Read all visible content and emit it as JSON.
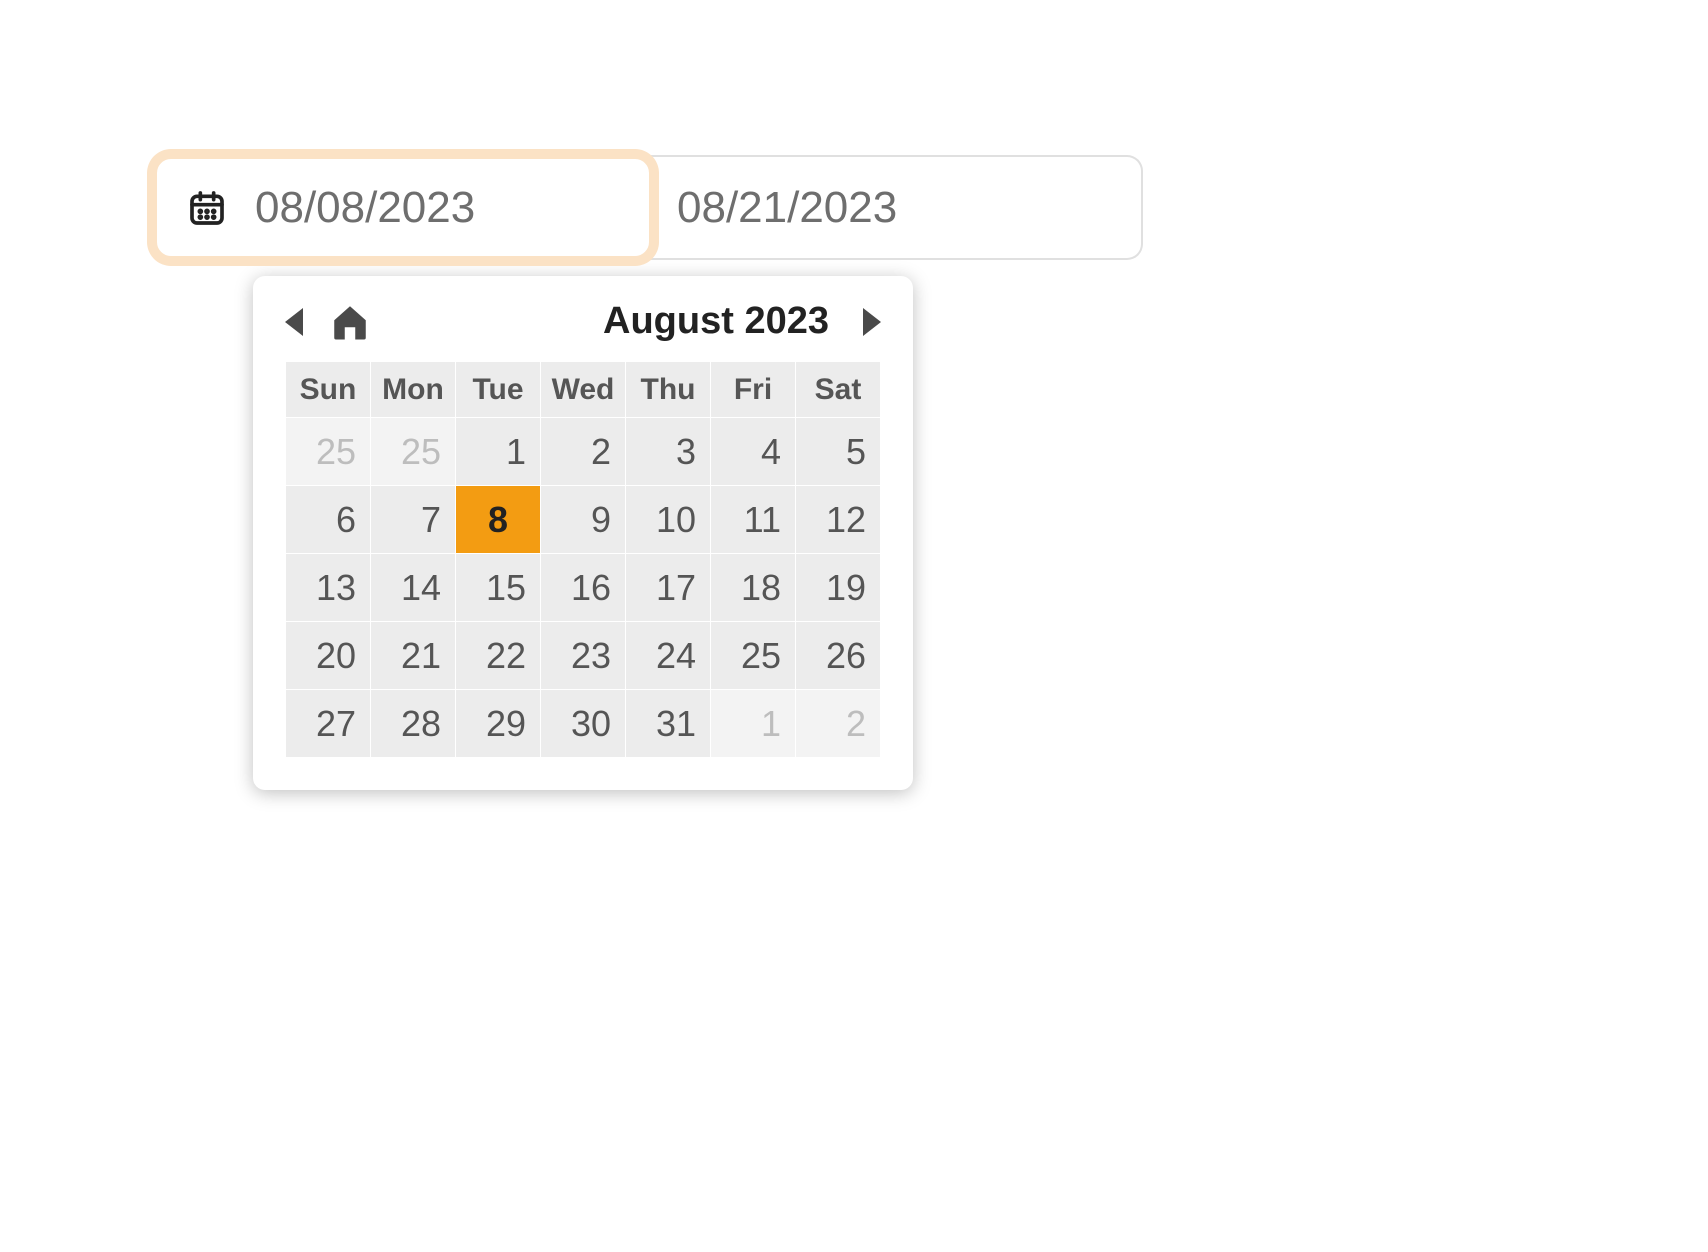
{
  "date_range": {
    "start": "08/08/2023",
    "end": "08/21/2023"
  },
  "calendar": {
    "month_label": "August 2023",
    "weekdays": [
      "Sun",
      "Mon",
      "Tue",
      "Wed",
      "Thu",
      "Fri",
      "Sat"
    ],
    "weeks": [
      [
        {
          "n": "25",
          "muted": true
        },
        {
          "n": "25",
          "muted": true
        },
        {
          "n": "1"
        },
        {
          "n": "2"
        },
        {
          "n": "3"
        },
        {
          "n": "4"
        },
        {
          "n": "5"
        }
      ],
      [
        {
          "n": "6"
        },
        {
          "n": "7"
        },
        {
          "n": "8",
          "selected": true
        },
        {
          "n": "9"
        },
        {
          "n": "10"
        },
        {
          "n": "11"
        },
        {
          "n": "12"
        }
      ],
      [
        {
          "n": "13"
        },
        {
          "n": "14"
        },
        {
          "n": "15"
        },
        {
          "n": "16"
        },
        {
          "n": "17"
        },
        {
          "n": "18"
        },
        {
          "n": "19"
        }
      ],
      [
        {
          "n": "20"
        },
        {
          "n": "21"
        },
        {
          "n": "22"
        },
        {
          "n": "23"
        },
        {
          "n": "24"
        },
        {
          "n": "25"
        },
        {
          "n": "26"
        }
      ],
      [
        {
          "n": "27"
        },
        {
          "n": "28"
        },
        {
          "n": "29"
        },
        {
          "n": "30"
        },
        {
          "n": "31"
        },
        {
          "n": "1",
          "muted": true
        },
        {
          "n": "2",
          "muted": true
        }
      ]
    ]
  }
}
